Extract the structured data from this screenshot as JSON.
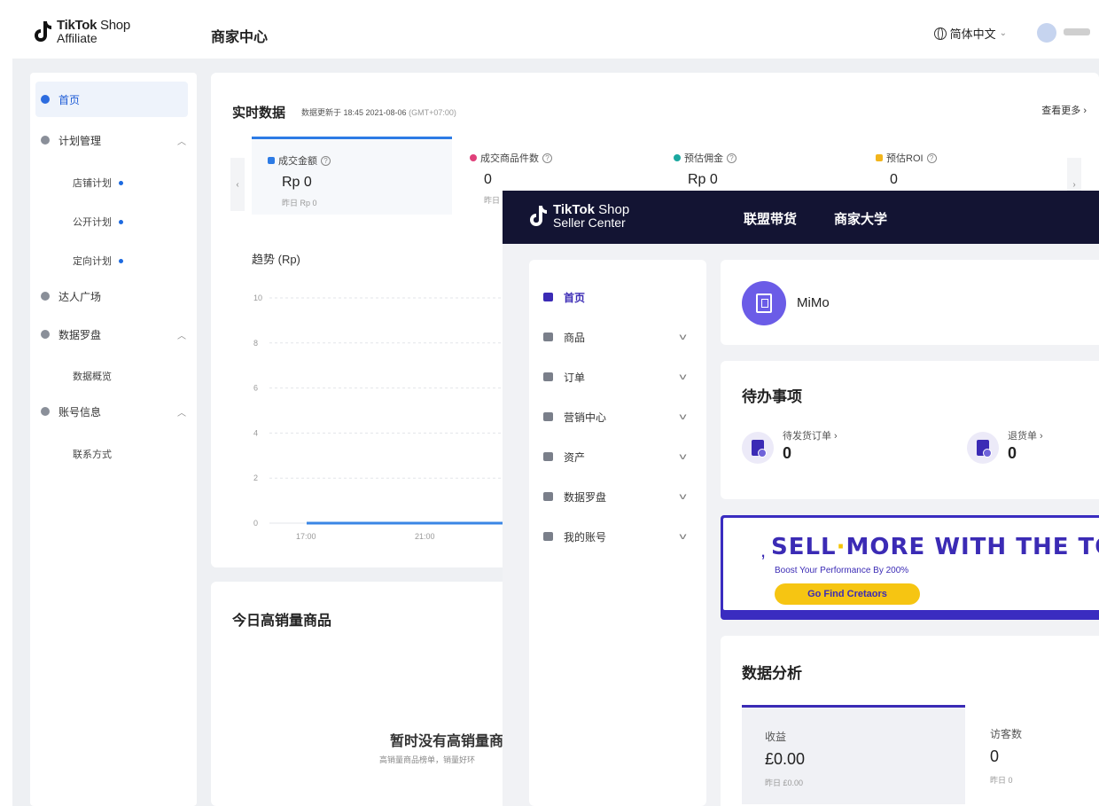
{
  "affiliate": {
    "logo_line1_bold": "TikTok",
    "logo_line1_thin": " Shop",
    "logo_line2": "Affiliate",
    "header_title": "商家中心",
    "language": "简体中文",
    "sidebar": {
      "home": "首页",
      "plan_mgmt": "计划管理",
      "shop_plan": "店铺计划",
      "public_plan": "公开计划",
      "targeted_plan": "定向计划",
      "creator_square": "达人广场",
      "data_compass": "数据罗盘",
      "data_overview": "数据概览",
      "account_info": "账号信息",
      "contact": "联系方式"
    },
    "realtime": {
      "title": "实时数据",
      "updated": "数据更新于 18:45 2021-08-06",
      "timezone": "(GMT+07:00)",
      "view_more": "查看更多",
      "metrics": [
        {
          "label": "成交金额",
          "value": "Rp 0",
          "yesterday": "昨日 Rp 0",
          "color": "#2d7be5"
        },
        {
          "label": "成交商品件数",
          "value": "0",
          "yesterday": "昨日",
          "color": "#e0407a"
        },
        {
          "label": "预估佣金",
          "value": "Rp 0",
          "yesterday": "",
          "color": "#1ba8a0"
        },
        {
          "label": "预估ROI",
          "value": "0",
          "yesterday": "",
          "color": "#f2b51c"
        }
      ],
      "trend_title": "趋势 (Rp)"
    },
    "hot": {
      "title": "今日高销量商品",
      "empty": "暂时没有高销量商品",
      "hint": "高销量商品榜单，销量好环"
    }
  },
  "chart_data": {
    "type": "line",
    "title": "趋势 (Rp)",
    "x": [
      "17:00",
      "21:00"
    ],
    "yticks": [
      0,
      2,
      4,
      6,
      8,
      10
    ],
    "ylim": [
      0,
      10
    ],
    "series": [
      {
        "values": [
          0,
          0
        ]
      }
    ],
    "grid": true
  },
  "seller": {
    "logo_line1_bold": "TikTok",
    "logo_line1_thin": " Shop",
    "logo_line2": "Seller Center",
    "nav": [
      "联盟带货",
      "商家大学"
    ],
    "sidebar": [
      {
        "label": "首页",
        "active": true,
        "caret": false
      },
      {
        "label": "商品",
        "caret": true
      },
      {
        "label": "订单",
        "caret": true
      },
      {
        "label": "营销中心",
        "caret": true
      },
      {
        "label": "资产",
        "caret": true
      },
      {
        "label": "数据罗盘",
        "caret": true
      },
      {
        "label": "我的账号",
        "caret": true
      }
    ],
    "shop_name": "MiMo",
    "todo": {
      "title": "待办事项",
      "items": [
        {
          "label": "待发货订单 ›",
          "value": "0"
        },
        {
          "label": "退货单 ›",
          "value": "0"
        }
      ]
    },
    "banner": {
      "headline_1": "SELL",
      "headline_2": "MORE WITH THE TO",
      "sub": "Boost Your Performance By 200%",
      "button": "Go Find Cretaors"
    },
    "analysis": {
      "title": "数据分析",
      "boxes": [
        {
          "label": "收益",
          "value": "£0.00",
          "yesterday": "昨日 £0.00"
        },
        {
          "label": "访客数",
          "value": "0",
          "yesterday": "昨日 0"
        }
      ]
    }
  }
}
